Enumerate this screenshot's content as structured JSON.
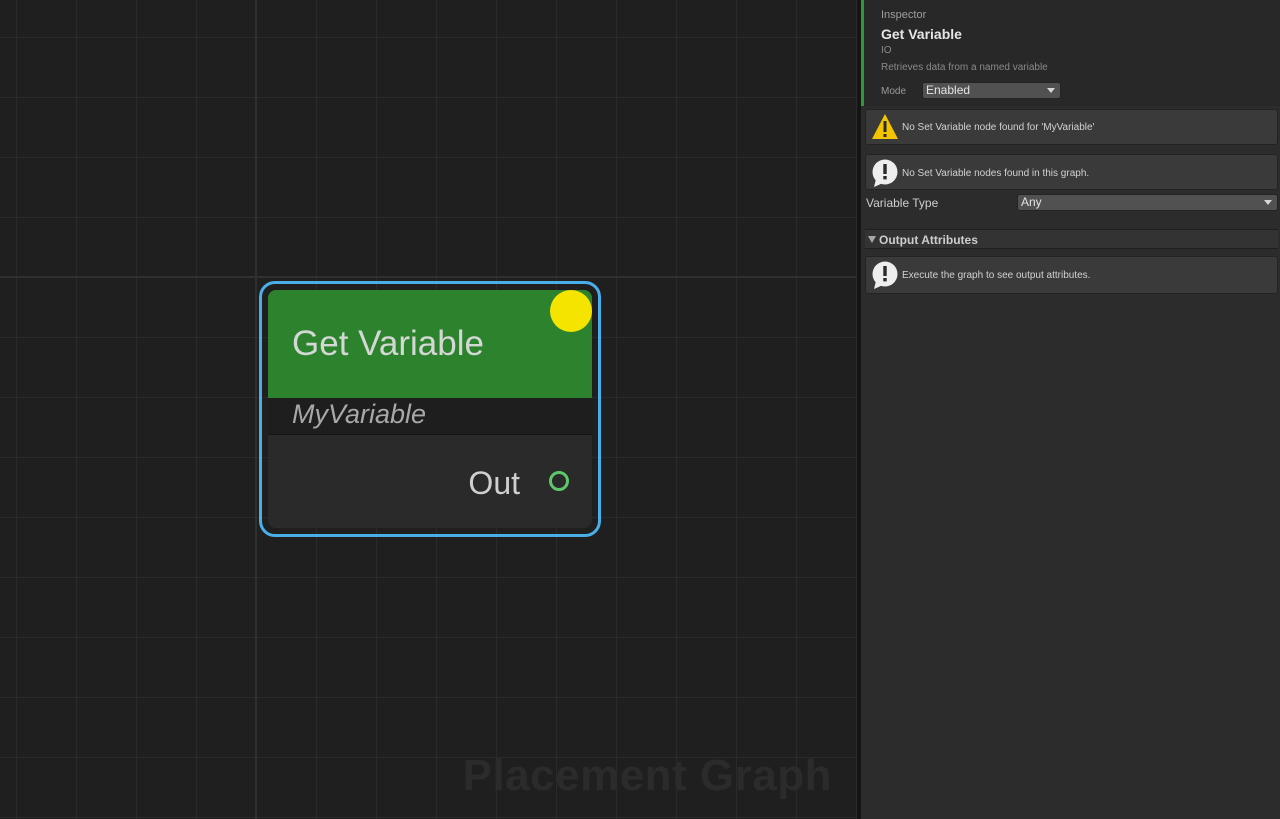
{
  "canvas": {
    "watermark": "Placement Graph"
  },
  "node": {
    "title": "Get Variable",
    "subtitle": "MyVariable",
    "output_pin_label": "Out",
    "header_color": "#2d822e",
    "selection_color": "#4aaee8",
    "status_color": "#f5e400",
    "pin_color": "#5dc86a"
  },
  "inspector": {
    "caption": "Inspector",
    "title": "Get Variable",
    "category": "IO",
    "description": "Retrieves data from a named variable",
    "mode_label": "Mode",
    "mode_value": "Enabled",
    "warning_message": "No Set Variable node found for 'MyVariable'",
    "info_message": "No Set Variable nodes found in this graph.",
    "variable_type_label": "Variable Type",
    "variable_type_value": "Any",
    "output_section_label": "Output Attributes",
    "output_info_message": "Execute the graph to see output attributes.",
    "accent_color": "#2e9a36",
    "warning_color": "#f5c400"
  }
}
